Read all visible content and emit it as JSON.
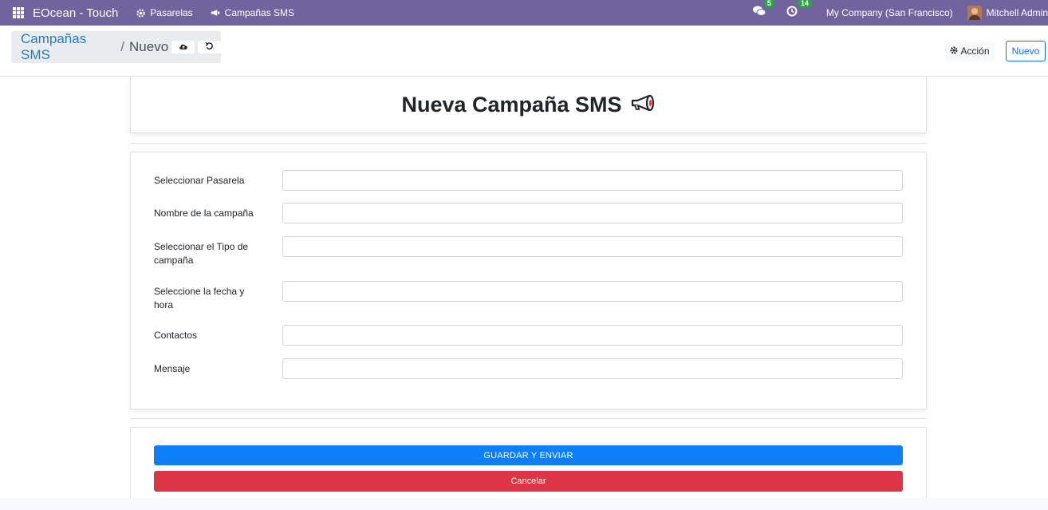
{
  "navbar": {
    "app_name": "EOcean - Touch",
    "menu": [
      {
        "label": "Pasarelas",
        "icon": "gear-icon"
      },
      {
        "label": "Campañas SMS",
        "icon": "megaphone-icon"
      }
    ],
    "messages_count": "5",
    "activities_count": "14",
    "company": "My Company (San Francisco)",
    "user": "Mitchell Admin",
    "color": "#71639e"
  },
  "control_panel": {
    "breadcrumb_parent": "Campañas SMS",
    "breadcrumb_separator": "/",
    "breadcrumb_current": "Nuevo",
    "action_label": "Acción",
    "new_label": "Nuevo"
  },
  "form": {
    "title": "Nueva Campaña SMS",
    "fields": [
      {
        "label": "Seleccionar Pasarela",
        "value": ""
      },
      {
        "label": "Nombre de la campaña",
        "value": ""
      },
      {
        "label": "Seleccionar el Tipo de campaña",
        "value": ""
      },
      {
        "label": "Seleccione la fecha y hora",
        "value": ""
      },
      {
        "label": "Contactos",
        "value": ""
      },
      {
        "label": "Mensaje",
        "value": ""
      }
    ],
    "save_label": "GUARDAR Y ENVIAR",
    "cancel_label": "Cancelar",
    "primary_color": "#0d80f8",
    "danger_color": "#dc3545"
  }
}
